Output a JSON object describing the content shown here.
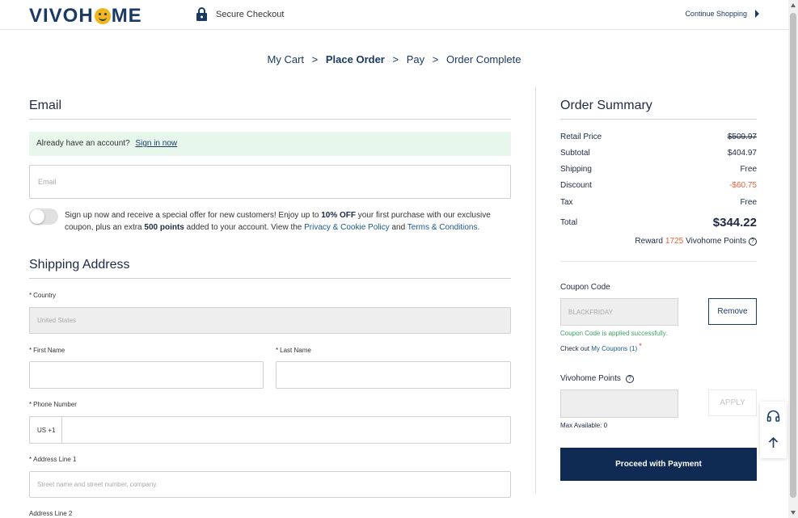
{
  "header": {
    "logo": "VIVOHOME",
    "secure_checkout": "Secure Checkout",
    "continue_shopping": "Continue Shopping"
  },
  "steps": [
    {
      "label": "My Cart",
      "active": false
    },
    {
      "label": "Place Order",
      "active": true
    },
    {
      "label": "Pay",
      "active": false
    },
    {
      "label": "Order Complete",
      "active": false
    }
  ],
  "email": {
    "title": "Email",
    "already_account": "Already have an account?",
    "sign_in": "Sign in now",
    "placeholder": "Email"
  },
  "promo": {
    "text1": "Sign up now and receive a special offer for new customers! Enjoy up to ",
    "bold1": "10% OFF",
    "text2": " your first purchase with our exclusive coupon, plus an extra ",
    "bold2": "500 points",
    "text3": " added to your account. View the ",
    "privacy_link": "Privacy & Cookie Policy",
    "and": " and ",
    "terms_link": "Terms & Conditions",
    "period": "."
  },
  "shipping": {
    "title": "Shipping Address",
    "country_label": "Country",
    "country_value": "United States",
    "first_name_label": "First Name",
    "last_name_label": "Last Name",
    "phone_label": "Phone Number",
    "phone_prefix": "US +1",
    "address1_label": "Address Line 1",
    "address1_placeholder": "Street name and street number, company.",
    "address2_label": "Address Line 2"
  },
  "summary": {
    "title": "Order Summary",
    "rows": [
      {
        "label": "Retail Price",
        "value": "$509.97"
      },
      {
        "label": "Subtotal",
        "value": "$404.97"
      },
      {
        "label": "Shipping",
        "value": "Free"
      },
      {
        "label": "Discount",
        "value": "-$60.75"
      },
      {
        "label": "Tax",
        "value": "Free"
      }
    ],
    "total_label": "Total",
    "total_value": "$344.22",
    "reward_prefix": "Reward",
    "reward_points": "1725",
    "reward_suffix": "Vivohome Points"
  },
  "coupon": {
    "label": "Coupon Code",
    "value": "BLACKFRIDAY",
    "remove": "Remove",
    "applied_msg": "Coupon Code is applied successfully.",
    "check_out": "Check out",
    "my_coupons": "My Coupons (1)"
  },
  "points": {
    "label": "Vivohome Points",
    "apply": "APPLY",
    "max_available": "Max Available: 0"
  },
  "pay_button": "Proceed with Payment",
  "colors": {
    "brand_navy": "#0f2b54",
    "accent_orange": "#e8623a",
    "success_green": "#3ba55d",
    "signin_bg": "#e7f7ec"
  }
}
